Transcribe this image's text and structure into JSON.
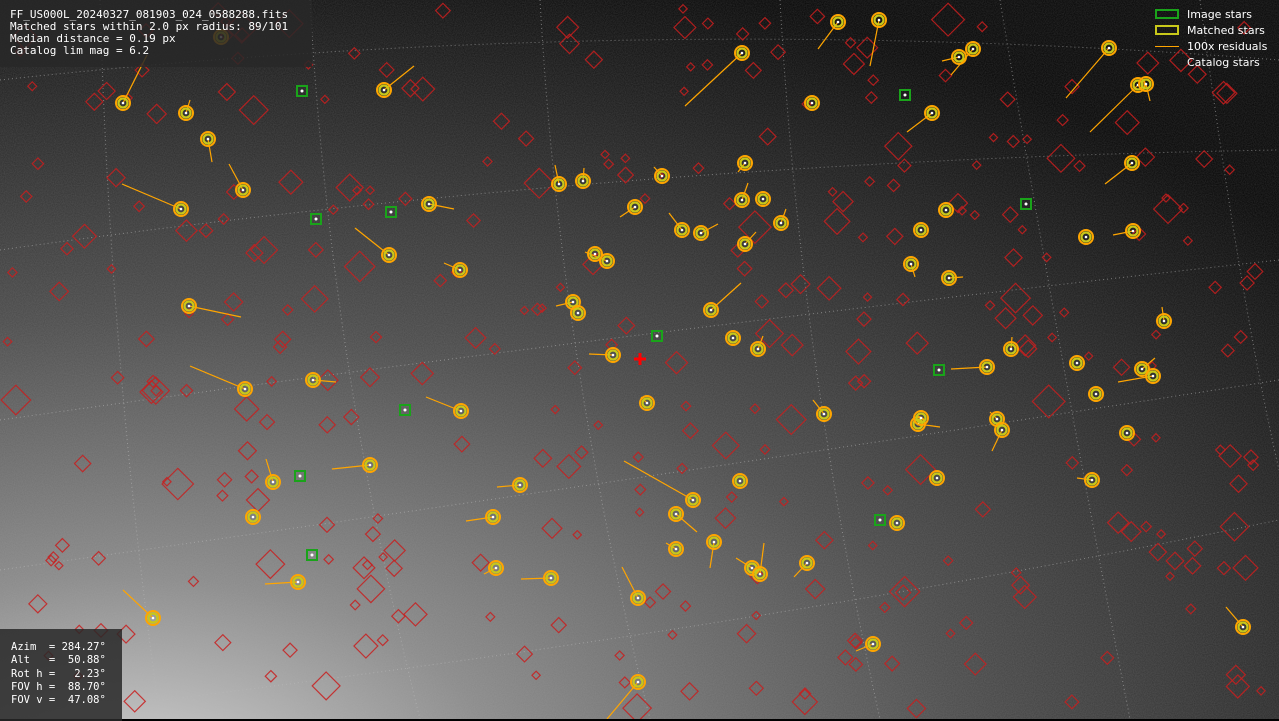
{
  "info": {
    "filename": "FF_US000L_20240327_081903_024_0588288.fits",
    "matched": "Matched stars within 2.0 px radius: 89/101",
    "median": "Median distance = 0.19 px",
    "catalog_lim": "Catalog lim mag = 6.2"
  },
  "pointing": {
    "azim": "Azim  = 284.27°",
    "alt": "Alt   =  50.88°",
    "rot": "Rot h =   2.23°",
    "fov_h": "FOV h =  88.70°",
    "fov_v": "FOV v =  47.08°"
  },
  "legend": {
    "image_stars": "Image stars",
    "matched_stars": "Matched stars",
    "residuals": "100x residuals",
    "catalog_stars": "Catalog stars"
  },
  "colors": {
    "image_star": "#1aa31a",
    "matched_star": "#c8c81a",
    "residual": "#ffa500",
    "catalog_star": "#c81e1e",
    "centre_marker": "#ff0000"
  }
}
